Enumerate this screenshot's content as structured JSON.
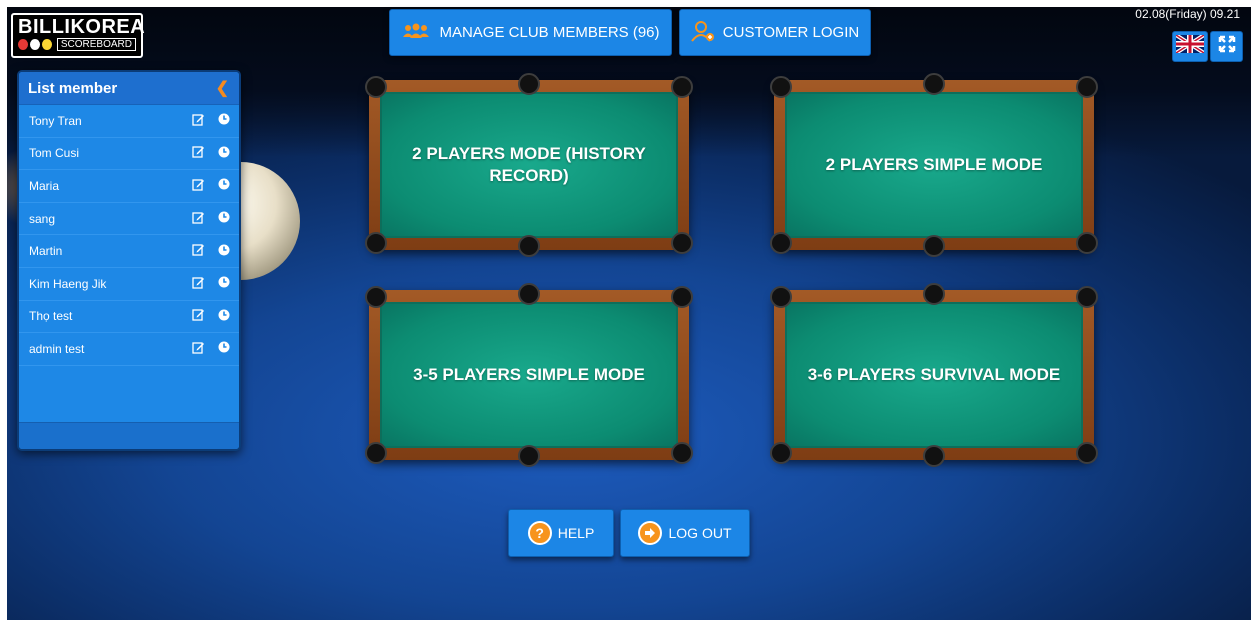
{
  "brand": {
    "name": "BILLIKOREA",
    "subtitle": "SCOREBOARD",
    "dot_colors": [
      "#e53935",
      "#ffffff",
      "#fdd835"
    ]
  },
  "header": {
    "manage_members_label": "MANAGE CLUB MEMBERS (96)",
    "customer_login_label": "CUSTOMER LOGIN",
    "datetime": "02.08(Friday) 09.21",
    "language_icon": "uk-flag-icon",
    "fullscreen_icon": "fullscreen-icon"
  },
  "sidebar": {
    "title": "List member",
    "collapse_icon": "chevron-left-icon",
    "members": [
      {
        "name": "Tony Tran"
      },
      {
        "name": "Tom Cusi"
      },
      {
        "name": "Maria"
      },
      {
        "name": "sang"
      },
      {
        "name": "Martin"
      },
      {
        "name": "Kim Haeng Jik"
      },
      {
        "name": "Thọ test"
      },
      {
        "name": "admin test"
      }
    ],
    "row_actions": [
      "edit-icon",
      "clock-icon"
    ]
  },
  "modes": [
    {
      "label": "2 PLAYERS MODE (HISTORY RECORD)"
    },
    {
      "label": "2 PLAYERS SIMPLE MODE"
    },
    {
      "label": "3-5 PLAYERS SIMPLE MODE"
    },
    {
      "label": "3-6 PLAYERS SURVIVAL MODE"
    }
  ],
  "footer": {
    "help_label": "HELP",
    "logout_label": "LOG OUT"
  },
  "colors": {
    "button_blue": "#1c86e6",
    "accent_orange": "#f7941d",
    "felt_green": "#0c8c72"
  }
}
